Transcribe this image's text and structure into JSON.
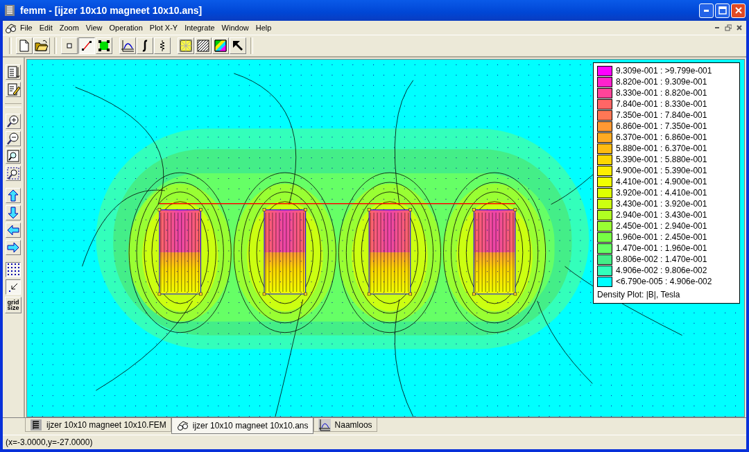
{
  "window": {
    "title": "femm - [ijzer 10x10 magneet 10x10.ans]"
  },
  "menu": [
    "File",
    "Edit",
    "Zoom",
    "View",
    "Operation",
    "Plot X-Y",
    "Integrate",
    "Window",
    "Help"
  ],
  "toolbar": {
    "mode_buttons": [
      {
        "kind": "node",
        "selected": false
      },
      {
        "kind": "segment",
        "selected": true
      },
      {
        "kind": "block",
        "selected": false
      }
    ]
  },
  "side_toolbar": {
    "grid_buttons": [
      {
        "kind": "show-grid",
        "on": true
      },
      {
        "kind": "snap-grid",
        "on": true
      }
    ],
    "grid_size_label": "grid size"
  },
  "legend": {
    "entries": [
      {
        "label": "9.309e-001 : >9.799e-001",
        "color": "#ff00ff"
      },
      {
        "label": "8.820e-001 : 9.309e-001",
        "color": "#ff22cc"
      },
      {
        "label": "8.330e-001 : 8.820e-001",
        "color": "#ff4499"
      },
      {
        "label": "7.840e-001 : 8.330e-001",
        "color": "#ff6666"
      },
      {
        "label": "7.350e-001 : 7.840e-001",
        "color": "#ff7755"
      },
      {
        "label": "6.860e-001 : 7.350e-001",
        "color": "#ff9933"
      },
      {
        "label": "6.370e-001 : 6.860e-001",
        "color": "#ffaa22"
      },
      {
        "label": "5.880e-001 : 6.370e-001",
        "color": "#ffbb11"
      },
      {
        "label": "5.390e-001 : 5.880e-001",
        "color": "#ffd700"
      },
      {
        "label": "4.900e-001 : 5.390e-001",
        "color": "#ffee00"
      },
      {
        "label": "4.410e-001 : 4.900e-001",
        "color": "#f0ff00"
      },
      {
        "label": "3.920e-001 : 4.410e-001",
        "color": "#ddff00"
      },
      {
        "label": "3.430e-001 : 3.920e-001",
        "color": "#ccff11"
      },
      {
        "label": "2.940e-001 : 3.430e-001",
        "color": "#b0ff22"
      },
      {
        "label": "2.450e-001 : 2.940e-001",
        "color": "#99ff33"
      },
      {
        "label": "1.960e-001 : 2.450e-001",
        "color": "#77ff44"
      },
      {
        "label": "1.470e-001 : 1.960e-001",
        "color": "#66ff66"
      },
      {
        "label": "9.806e-002 : 1.470e-001",
        "color": "#44ee88"
      },
      {
        "label": "4.906e-002 : 9.806e-002",
        "color": "#33ffbb"
      },
      {
        "label": "<6.790e-005 : 4.906e-002",
        "color": "#00ffff"
      }
    ],
    "caption": "Density Plot: |B|, Tesla"
  },
  "tabs": [
    {
      "label": "ijzer 10x10 magneet 10x10.FEM",
      "kind": "preprocessor",
      "selected": false
    },
    {
      "label": "ijzer 10x10 magneet 10x10.ans",
      "kind": "postprocessor",
      "selected": true
    },
    {
      "label": "Naamloos",
      "kind": "xy-plot",
      "selected": false
    }
  ],
  "status_bar": {
    "coordinates": "(x=-3.0000,y=-27.0000)"
  }
}
